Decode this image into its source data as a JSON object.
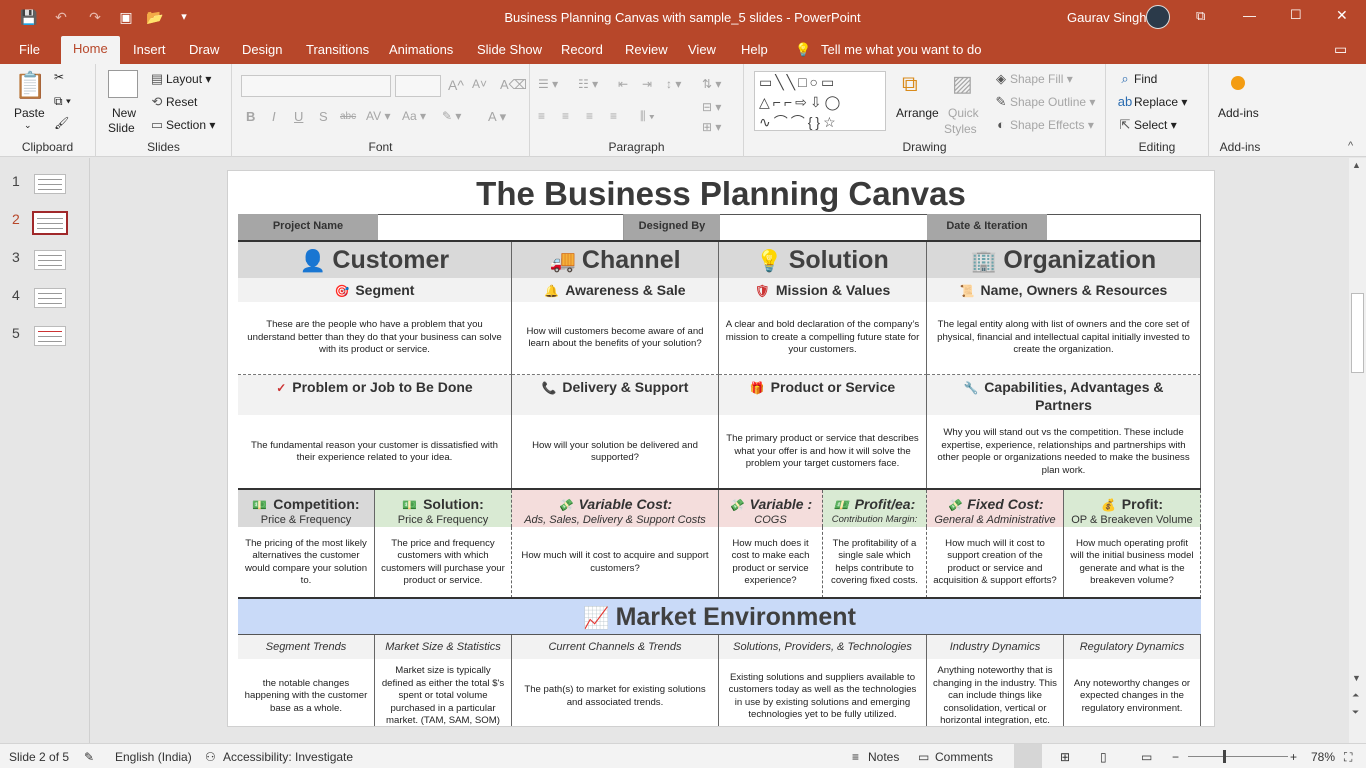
{
  "window": {
    "title": "Business Planning Canvas with sample_5 slides  -  PowerPoint",
    "user": "Gaurav Singh"
  },
  "qat": {
    "save": "💾",
    "undo": "↶",
    "redo": "↷",
    "present": "▣",
    "open": "📂",
    "more": "▾"
  },
  "win_controls": {
    "restore": "⧉",
    "minimize": "—",
    "maximize": "☐",
    "close": "✕"
  },
  "tabs": [
    "File",
    "Home",
    "Insert",
    "Draw",
    "Design",
    "Transitions",
    "Animations",
    "Slide Show",
    "Record",
    "Review",
    "View",
    "Help"
  ],
  "tell_me": "Tell me what you want to do",
  "ribbon": {
    "clipboard": {
      "paste": "Paste",
      "label": "Clipboard"
    },
    "slides": {
      "new_slide": "New",
      "new_slide2": "Slide",
      "layout": "Layout",
      "reset": "Reset",
      "section": "Section",
      "label": "Slides"
    },
    "font": {
      "label": "Font"
    },
    "paragraph": {
      "label": "Paragraph"
    },
    "drawing": {
      "arrange": "Arrange",
      "quick_styles": "Quick",
      "quick_styles2": "Styles",
      "shape_fill": "Shape Fill",
      "shape_outline": "Shape Outline",
      "shape_effects": "Shape Effects",
      "label": "Drawing"
    },
    "editing": {
      "find": "Find",
      "replace": "Replace",
      "select": "Select",
      "label": "Editing"
    },
    "addins": {
      "addins": "Add-ins",
      "label": "Add-ins"
    }
  },
  "thumbnails": [
    {
      "num": "1"
    },
    {
      "num": "2"
    },
    {
      "num": "3"
    },
    {
      "num": "4"
    },
    {
      "num": "5"
    }
  ],
  "slide": {
    "title": "The Business Planning Canvas",
    "header": {
      "project_name": "Project Name",
      "designed_by": "Designed By",
      "date_iteration": "Date & Iteration"
    },
    "columns": [
      {
        "icon": "👤",
        "title": "Customer"
      },
      {
        "icon": "🚚",
        "title": "Channel"
      },
      {
        "icon": "💡",
        "title": "Solution"
      },
      {
        "icon": "🏢",
        "title": "Organization"
      }
    ],
    "row1": [
      {
        "icon": "🎯",
        "title": "Segment",
        "body": "These are the people who have a problem that you understand better than they do that your business can solve with its product or service."
      },
      {
        "icon": "🔔",
        "title": "Awareness & Sale",
        "body": "How will customers become aware of and learn about the benefits of your solution?"
      },
      {
        "icon": "🛡",
        "title": "Mission & Values",
        "body": "A clear and bold declaration of the company’s mission to create a compelling future state for your customers."
      },
      {
        "icon": "📜",
        "title": "Name, Owners & Resources",
        "body": "The legal entity along with list of owners and the core set of physical, financial and intellectual capital initially invested to create the organization."
      }
    ],
    "row2": [
      {
        "icon": "✓",
        "title": "Problem or Job to Be Done",
        "body": "The fundamental reason your customer is dissatisfied with their experience related to your idea."
      },
      {
        "icon": "📞",
        "title": "Delivery & Support",
        "body": "How will your solution be delivered and supported?"
      },
      {
        "icon": "🎁",
        "title": "Product or Service",
        "body": "The primary product or service that describes what your offer is and how it will solve the problem your target customers face."
      },
      {
        "icon": "🔧",
        "title": "Capabilities, Advantages & Partners",
        "body": "Why you will stand out vs the competition. These include expertise, experience, relationships and partnerships with other people or organizations needed to make the business plan work."
      }
    ],
    "row3": [
      {
        "icon": "💵",
        "title": "Competition:",
        "sub": "Price & Frequency",
        "body": "The pricing of the most likely alternatives the customer would compare your solution to.",
        "bg": "#d9d9d9"
      },
      {
        "icon": "💵",
        "title": "Solution:",
        "sub": "Price & Frequency",
        "body": "The price and frequency customers with which customers will purchase your product or service.",
        "bg": "#d9ead3"
      },
      {
        "icon": "💸",
        "title": "Variable Cost:",
        "sub": "Ads, Sales, Delivery & Support Costs",
        "body": "How much will it cost to acquire and support customers?",
        "bg": "#f4dddc"
      },
      {
        "icon": "💸",
        "title": "Variable :",
        "sub": "COGS",
        "body": "How much does it cost to make each product or service experience?",
        "bg": "#f4dddc"
      },
      {
        "icon": "💵",
        "title": "Profit/ea:",
        "sub": "Contribution Margin:",
        "body": "The profitability of a single sale which helps contribute to covering fixed costs.",
        "bg": "#d9ead3"
      },
      {
        "icon": "💸",
        "title": "Fixed Cost:",
        "sub": "General & Administrative",
        "body": "How much will it cost to support creation of the product or service and acquisition & support efforts?",
        "bg": "#f4dddc"
      },
      {
        "icon": "💰",
        "title": "Profit:",
        "sub": "OP & Breakeven Volume",
        "body": "How much operating profit will the initial business model generate and what is the breakeven volume?",
        "bg": "#d9ead3"
      }
    ],
    "market": {
      "icon": "📈",
      "title": "Market Environment",
      "cols": [
        {
          "title": "Segment Trends",
          "body": "the notable changes happening with the customer base as a whole."
        },
        {
          "title": "Market Size & Statistics",
          "body": "Market size is typically defined as either the total $'s spent or total volume purchased in a particular market. (TAM, SAM, SOM)"
        },
        {
          "title": "Current Channels & Trends",
          "body": "The path(s) to market for existing solutions and associated trends."
        },
        {
          "title": "Solutions, Providers, & Technologies",
          "body": "Existing solutions and suppliers available to customers today as well as the technologies in use by existing solutions and emerging technologies yet to be fully utilized."
        },
        {
          "title": "Industry Dynamics",
          "body": "Anything noteworthy that is changing in the industry. This can include things like consolidation, vertical or horizontal integration, etc."
        },
        {
          "title": "Regulatory Dynamics",
          "body": "Any noteworthy changes or expected changes in the regulatory environment."
        }
      ]
    }
  },
  "status": {
    "slide_info": "Slide 2 of 5",
    "language": "English (India)",
    "accessibility": "Accessibility: Investigate",
    "notes": "Notes",
    "comments": "Comments",
    "zoom": "78%"
  }
}
